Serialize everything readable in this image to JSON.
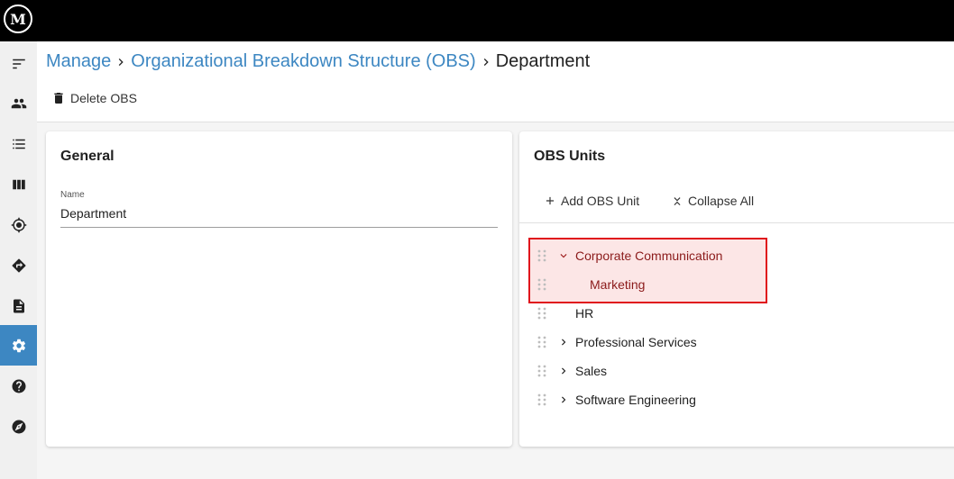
{
  "app": {
    "logo_text": "M"
  },
  "sidebar": {
    "items": [
      {
        "icon": "menu-collapse-icon"
      },
      {
        "icon": "people-icon"
      },
      {
        "icon": "list-icon"
      },
      {
        "icon": "board-icon"
      },
      {
        "icon": "target-icon"
      },
      {
        "icon": "directions-icon"
      },
      {
        "icon": "document-icon"
      },
      {
        "icon": "settings-icon",
        "active": true
      },
      {
        "icon": "help-icon"
      },
      {
        "icon": "compass-icon"
      }
    ]
  },
  "breadcrumb": {
    "items": [
      "Manage",
      "Organizational Breakdown Structure (OBS)",
      "Department"
    ]
  },
  "toolbar": {
    "delete_label": "Delete OBS"
  },
  "general": {
    "title": "General",
    "name_label": "Name",
    "name_value": "Department"
  },
  "obs": {
    "title": "OBS Units",
    "add_label": "Add OBS Unit",
    "collapse_label": "Collapse All",
    "units": [
      {
        "label": "Corporate Communication",
        "expanded": true,
        "highlighted": true
      },
      {
        "label": "Marketing",
        "child": true,
        "highlighted": true
      },
      {
        "label": "HR"
      },
      {
        "label": "Professional Services",
        "expanded": false
      },
      {
        "label": "Sales",
        "expanded": false
      },
      {
        "label": "Software Engineering",
        "expanded": false
      }
    ]
  },
  "colors": {
    "accent": "#3d87c2",
    "highlight_border": "#e0131c",
    "highlight_fill": "#fce6e6"
  }
}
